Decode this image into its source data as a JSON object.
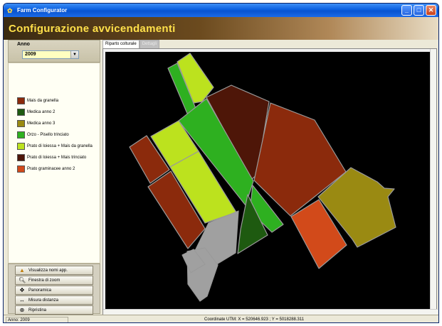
{
  "window": {
    "title": "Farm Configurator"
  },
  "header": {
    "title": "Configurazione avvicendamenti"
  },
  "year": {
    "label": "Anno",
    "selected": "2009"
  },
  "legend": [
    {
      "label": "Mais da granella",
      "color": "#8b2a0c"
    },
    {
      "label": "Medica anno 2",
      "color": "#1e5a10"
    },
    {
      "label": "Medica anno 3",
      "color": "#9a8a12"
    },
    {
      "label": "Orzo - Pisello trinciato",
      "color": "#2eb020"
    },
    {
      "label": "Prato di loiessa + Mais da granella",
      "color": "#bce21e"
    },
    {
      "label": "Prato di loiessa + Mais trinciato",
      "color": "#4e1608"
    },
    {
      "label": "Prato graminacee anno 2",
      "color": "#d24a1a"
    }
  ],
  "tools": [
    {
      "label": "Visualizza nomi app.",
      "icon": "names-icon"
    },
    {
      "label": "Finestra di zoom",
      "icon": "zoom-icon"
    },
    {
      "label": "Panoramica",
      "icon": "pan-icon"
    },
    {
      "label": "Misura distanza",
      "icon": "ruler-icon"
    },
    {
      "label": "Ripristina",
      "icon": "reset-icon"
    }
  ],
  "tabs": [
    {
      "label": "Riparto colturale",
      "active": true
    },
    {
      "label": "Dettagli",
      "active": false
    }
  ],
  "status": {
    "left": "Anno: 2009",
    "coords": "Coordinate UTM: X = 520646.923 ; Y = 5018288.311"
  },
  "parcel_colors": {
    "mais": "#8b2a0c",
    "medica2": "#1e5a10",
    "medica3": "#9a8a12",
    "orzo": "#2eb020",
    "prato_mais_granella": "#bce21e",
    "prato_mais_trinciato": "#4e1608",
    "prato_graminacee": "#d24a1a",
    "grey": "#a0a0a0"
  }
}
